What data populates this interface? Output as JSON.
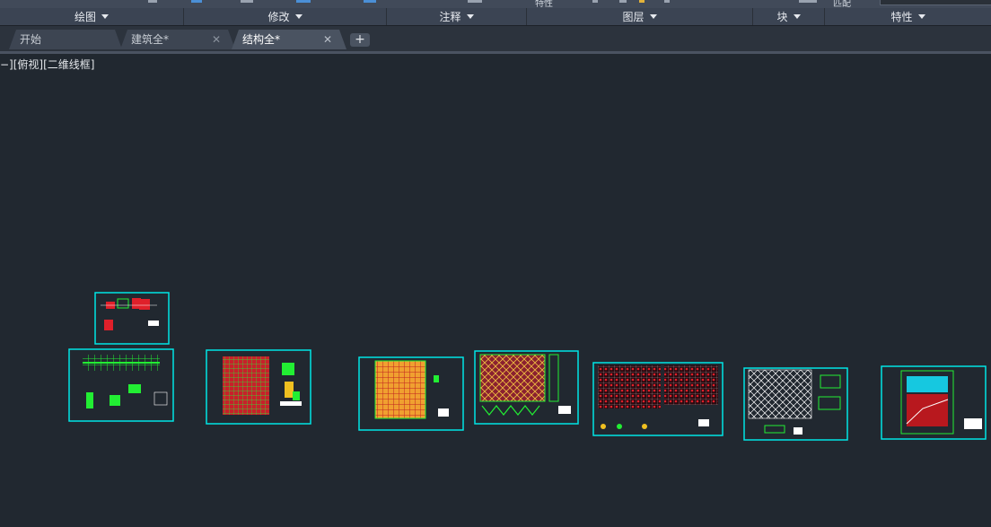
{
  "ribbon": {
    "panels": [
      {
        "label": "绘图"
      },
      {
        "label": "修改"
      },
      {
        "label": "注释"
      },
      {
        "label": "图层"
      },
      {
        "label": "块"
      },
      {
        "label": "特性"
      }
    ],
    "top_partial_texts": [
      "特性",
      "匹配"
    ]
  },
  "tabs": [
    {
      "label": "开始",
      "closable": false,
      "active": false
    },
    {
      "label": "建筑全*",
      "closable": true,
      "active": false
    },
    {
      "label": "结构全*",
      "closable": true,
      "active": true
    }
  ],
  "tab_add_symbol": "+",
  "tab_close_symbol": "✕",
  "viewport": {
    "label": "−][俯视][二维线框]"
  },
  "drawing_sheets": [
    {
      "name": "structure-detail-small"
    },
    {
      "name": "beam-plan-1"
    },
    {
      "name": "column-grid-plan"
    },
    {
      "name": "floor-grid-orange"
    },
    {
      "name": "truss-roof-plan"
    },
    {
      "name": "rebar-dual-plan"
    },
    {
      "name": "lattice-roof-plan"
    },
    {
      "name": "cross-section-sheet"
    }
  ],
  "colors": {
    "background": "#212830",
    "sheet_frame": "#00e5e5",
    "green": "#22ee33",
    "red": "#e0202a",
    "orange": "#f0a030",
    "white": "#ffffff"
  }
}
